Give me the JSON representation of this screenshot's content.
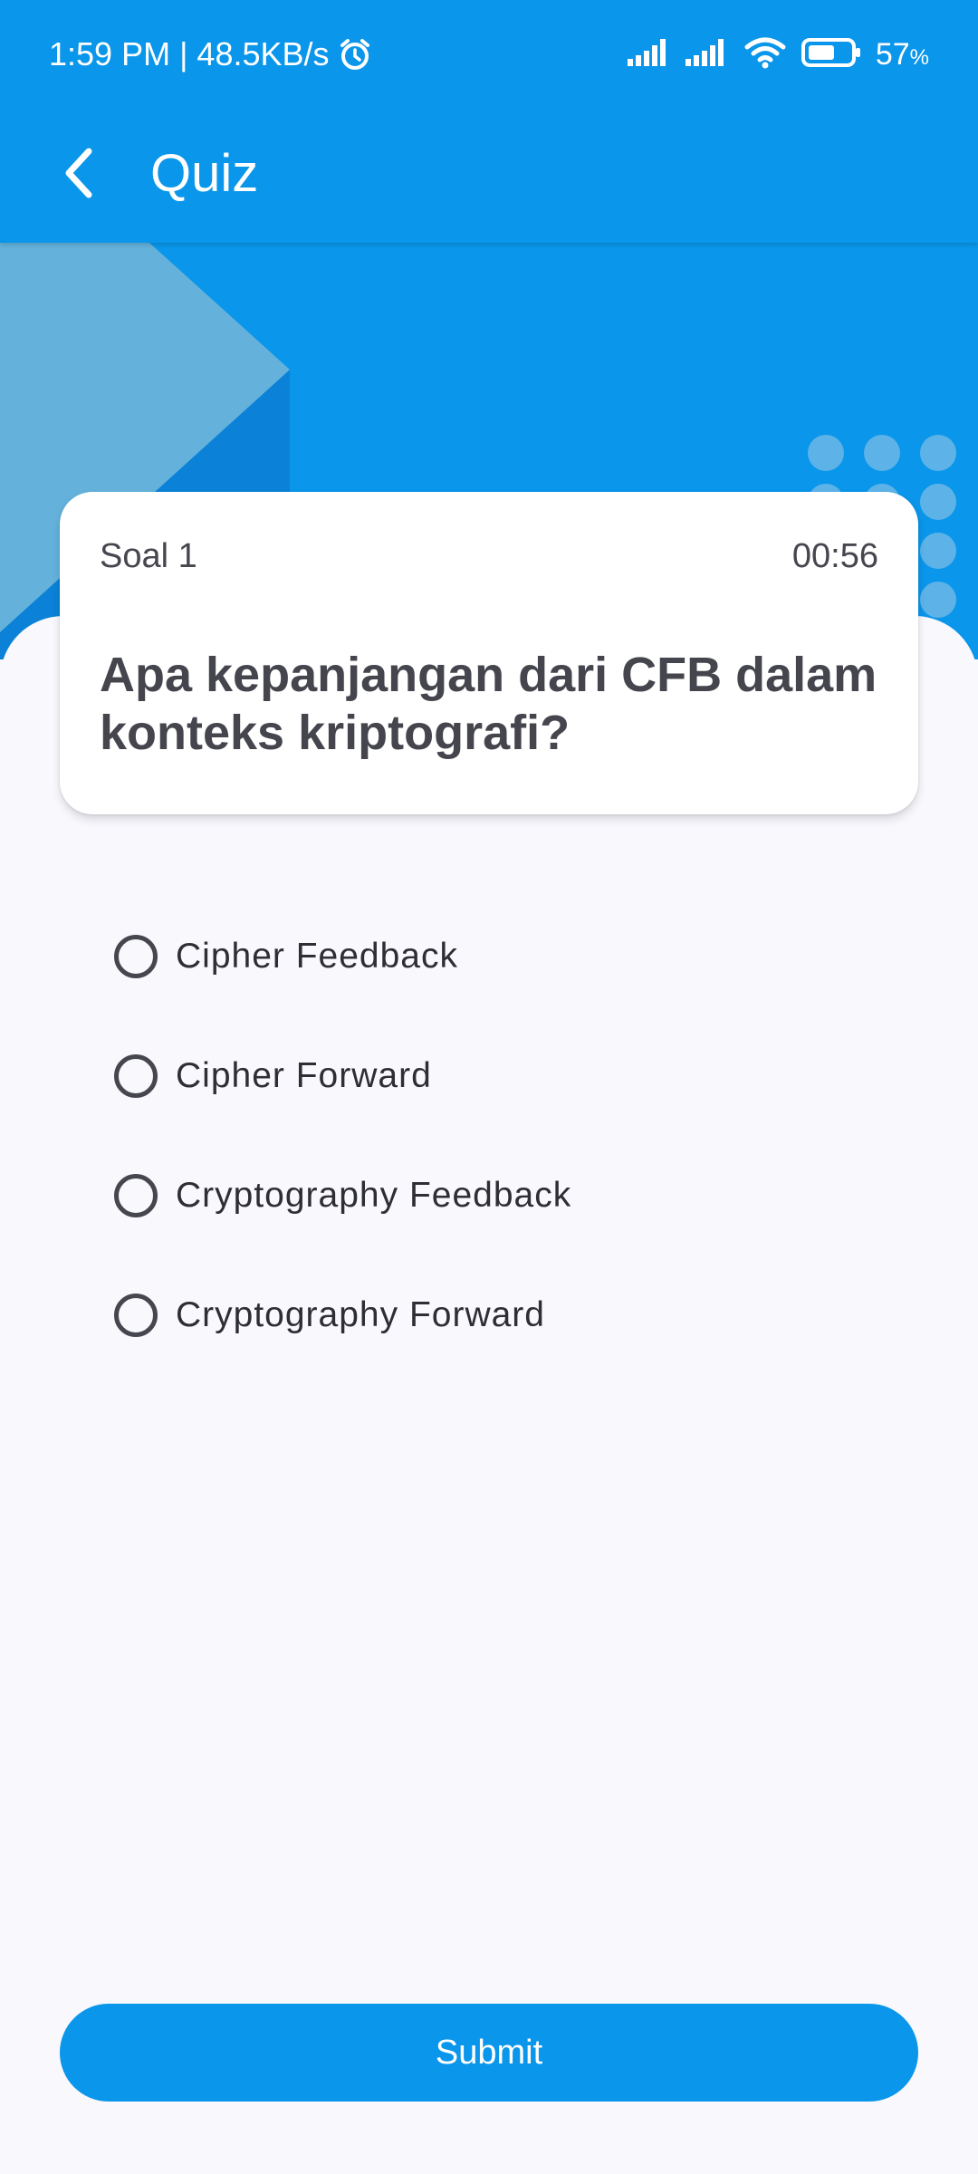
{
  "status_bar": {
    "time_speed": "1:59 PM | 48.5KB/s",
    "alarm_icon": "alarm-clock-icon",
    "signal_icons": [
      "signal-icon",
      "signal-icon"
    ],
    "wifi_icon": "wifi-icon",
    "battery_icon": "battery-icon",
    "battery_percent": "57",
    "battery_unit": "%"
  },
  "app_bar": {
    "back_icon": "chevron-left-icon",
    "title": "Quiz"
  },
  "question_card": {
    "number_label": "Soal 1",
    "timer": "00:56",
    "question": "Apa kepanjangan dari CFB dalam konteks kriptografi?"
  },
  "options": [
    {
      "label": "Cipher Feedback",
      "selected": false
    },
    {
      "label": "Cipher Forward",
      "selected": false
    },
    {
      "label": "Cryptography Feedback",
      "selected": false
    },
    {
      "label": "Cryptography Forward",
      "selected": false
    }
  ],
  "submit": {
    "label": "Submit"
  },
  "colors": {
    "primary": "#0a96ea",
    "background": "#f8f8fd",
    "card": "#ffffff",
    "text_dark": "#45454e"
  }
}
